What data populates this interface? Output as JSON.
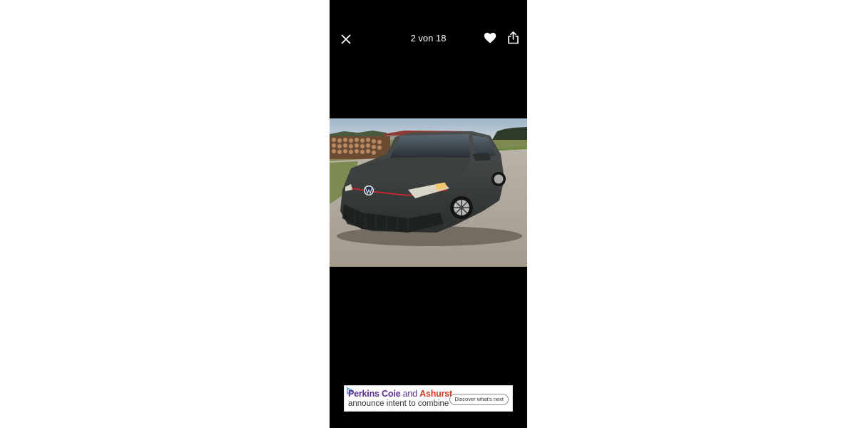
{
  "viewer": {
    "counter": "2 von 18",
    "icons": {
      "close": "close-icon",
      "favorite": "heart-icon",
      "share": "share-icon"
    }
  },
  "ad": {
    "brand1": "Perkins Coie",
    "connector": " and ",
    "brand2": "Ashurst",
    "line2": "announce intent to combine",
    "cta": "Discover what's next",
    "colors": {
      "brand1": "#5b2e8c",
      "brand2": "#d6361f"
    }
  }
}
